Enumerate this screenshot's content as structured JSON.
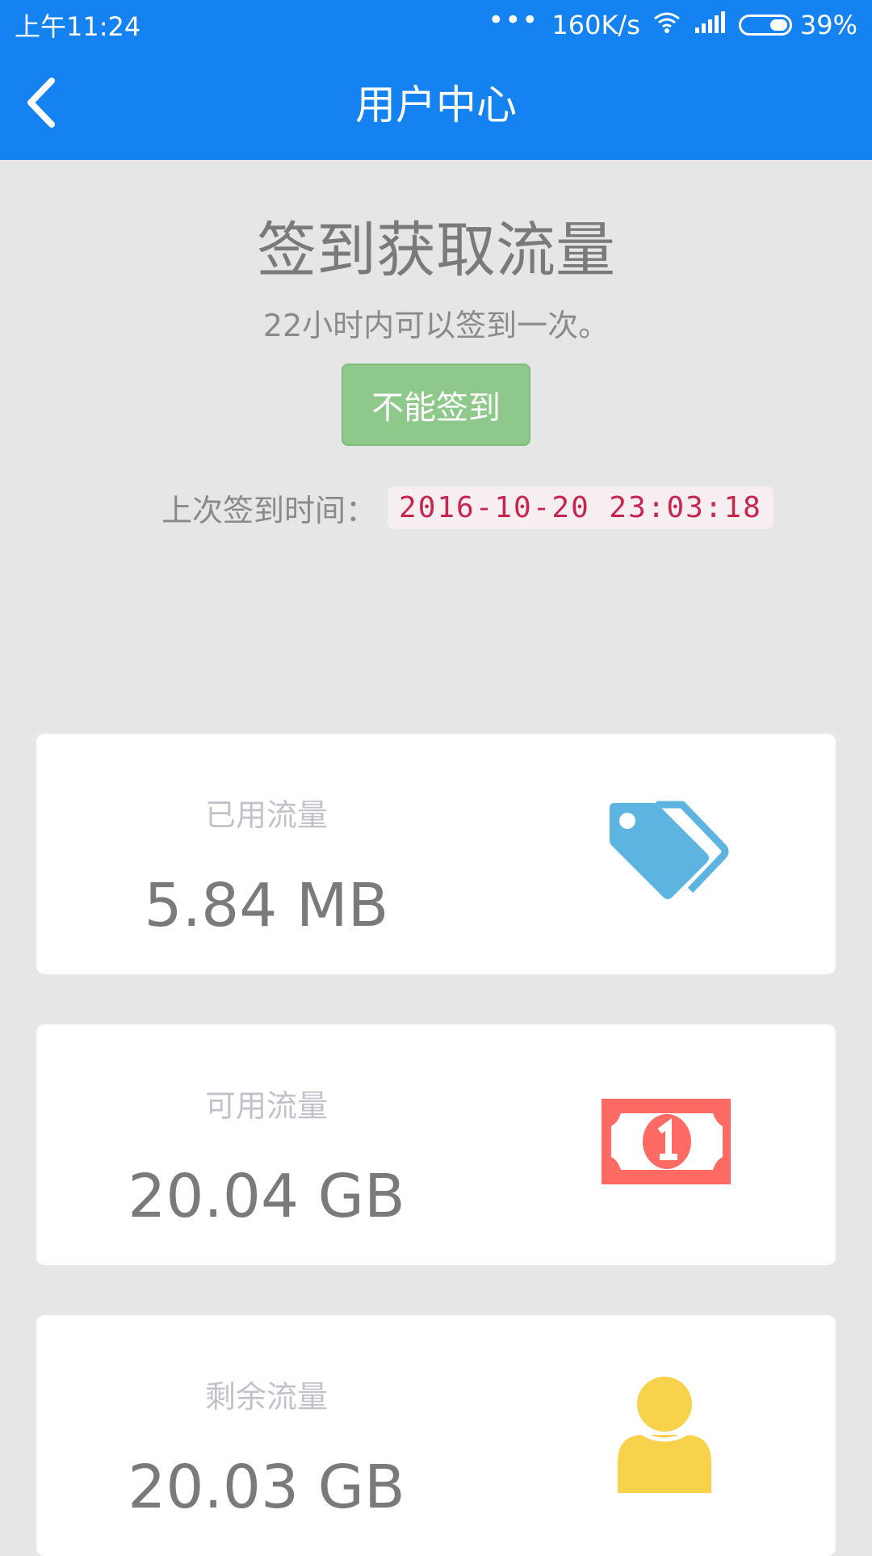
{
  "status_bar": {
    "time": "上午11:24",
    "dots": "•••",
    "speed": "160K/s",
    "battery_text": "39%",
    "battery_level": 0.39
  },
  "app_bar": {
    "title": "用户中心",
    "back_icon": "chevron-left-icon"
  },
  "checkin": {
    "title": "签到获取流量",
    "subtitle": "22小时内可以签到一次。",
    "button_label": "不能签到",
    "last_label": "上次签到时间：",
    "last_value": "2016-10-20 23:03:18",
    "colors": {
      "button_bg": "#8ec98b",
      "code_text": "#c7254e",
      "code_bg": "#f7eef1"
    }
  },
  "cards": [
    {
      "label": "已用流量",
      "value": "5.84 MB",
      "icon": "tags-icon",
      "icon_color": "#5db4e0"
    },
    {
      "label": "可用流量",
      "value": "20.04 GB",
      "icon": "money-bill-icon",
      "icon_color": "#ff6b64"
    },
    {
      "label": "剩余流量",
      "value": "20.03 GB",
      "icon": "user-icon",
      "icon_color": "#f7d24a"
    }
  ],
  "colors": {
    "primary": "#1482f0",
    "background": "#e6e6e6"
  }
}
